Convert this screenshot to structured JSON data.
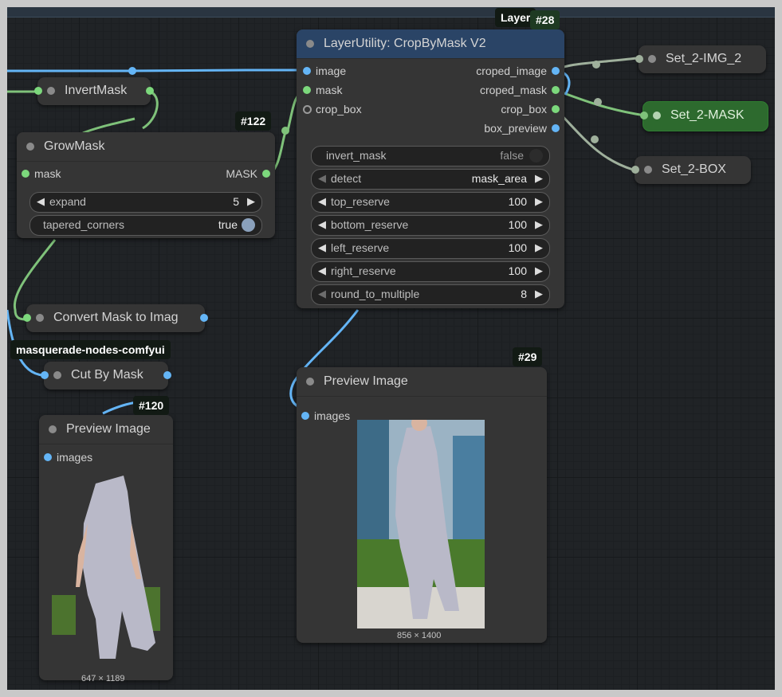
{
  "colors": {
    "canvas": "#202326",
    "node_bg": "#353535",
    "title_blue": "#2a4466",
    "green_node": "#2d6a2e",
    "wire_blue": "#64b5f6",
    "wire_green": "#7fc27a",
    "wire_gray": "#9fb09c"
  },
  "nodes": {
    "invert_mask": {
      "title": "InvertMask"
    },
    "grow_mask": {
      "title": "GrowMask",
      "badge": "#122",
      "input_mask": "mask",
      "output_mask": "MASK",
      "expand": {
        "label": "expand",
        "value": "5"
      },
      "tapered": {
        "label": "tapered_corners",
        "value": "true"
      }
    },
    "crop_by_mask": {
      "title": "LayerUtility: CropByMask V2",
      "badge": "#28",
      "badge_overlap": "Layer",
      "inputs": [
        "image",
        "mask",
        "crop_box"
      ],
      "outputs": [
        "croped_image",
        "croped_mask",
        "crop_box",
        "box_preview"
      ],
      "invert_mask": {
        "label": "invert_mask",
        "value": "false"
      },
      "detect": {
        "label": "detect",
        "value": "mask_area"
      },
      "top_reserve": {
        "label": "top_reserve",
        "value": "100"
      },
      "bottom_reserve": {
        "label": "bottom_reserve",
        "value": "100"
      },
      "left_reserve": {
        "label": "left_reserve",
        "value": "100"
      },
      "right_reserve": {
        "label": "right_reserve",
        "value": "100"
      },
      "round_to_multiple": {
        "label": "round_to_multiple",
        "value": "8"
      }
    },
    "set_img": {
      "title": "Set_2-IMG_2"
    },
    "set_mask": {
      "title": "Set_2-MASK"
    },
    "set_box": {
      "title": "Set_2-BOX"
    },
    "convert_mask": {
      "title": "Convert Mask to Imag"
    },
    "cut_by_mask": {
      "title": "Cut By Mask",
      "group_label": "masquerade-nodes-comfyui"
    },
    "preview_left": {
      "title": "Preview Image",
      "badge": "#120",
      "input": "images",
      "caption": "647 × 1189"
    },
    "preview_mid": {
      "title": "Preview Image",
      "badge": "#29",
      "input": "images",
      "caption": "856 × 1400"
    }
  }
}
